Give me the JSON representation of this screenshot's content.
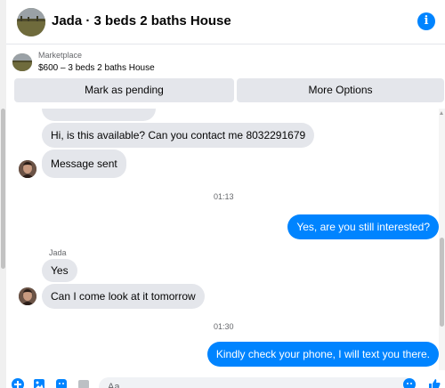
{
  "header": {
    "title": "Jada · 3 beds 2 baths House",
    "info_icon": "info-icon"
  },
  "marketplace": {
    "source_label": "Marketplace",
    "listing": "$600 – 3 beds 2 baths House",
    "mark_pending_label": "Mark as pending",
    "more_options_label": "More Options"
  },
  "messages": [
    {
      "direction": "in",
      "text": "Hi, is this available? Can you contact me 8032291679"
    },
    {
      "direction": "in",
      "text": "Message sent"
    },
    {
      "direction": "out",
      "text": "Yes, are you still interested?"
    },
    {
      "direction": "in",
      "text": "Yes"
    },
    {
      "direction": "in",
      "text": "Can I come look at it tomorrow"
    },
    {
      "direction": "out",
      "text": "Kindly check your phone, I will text you there."
    }
  ],
  "timestamps": [
    "01:13",
    "01:30"
  ],
  "sender_name": "Jada",
  "composer": {
    "placeholder": "Aa",
    "icons": [
      "add-icon",
      "photo-icon",
      "sticker-icon",
      "gif-icon",
      "emoji-icon",
      "like-icon"
    ]
  },
  "colors": {
    "accent": "#0084ff",
    "incoming_bubble": "#e4e6eb",
    "text": "#050505",
    "muted": "#65676b"
  }
}
